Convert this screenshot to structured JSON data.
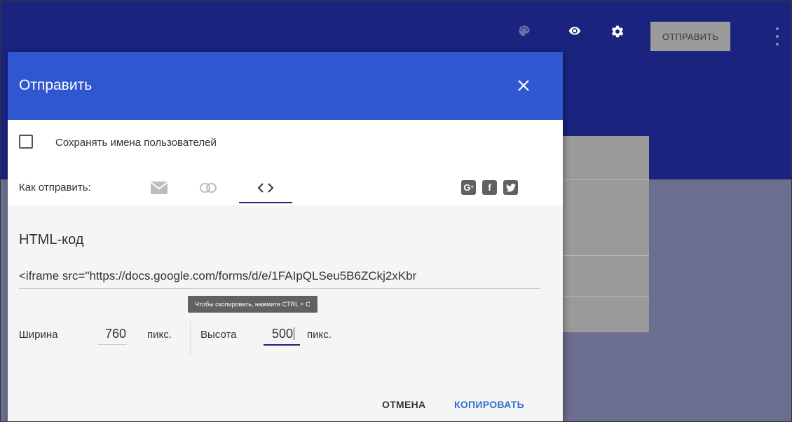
{
  "topbar": {
    "send_label": "ОТПРАВИТЬ",
    "icons": [
      "palette-icon",
      "eye-icon",
      "gear-icon",
      "more-vert-icon"
    ],
    "bg_color": "#1a237e"
  },
  "dialog": {
    "title": "Отправить",
    "header_color": "#2f57d0",
    "save_names_label": "Сохранять имена пользователей",
    "save_names_checked": false,
    "how_to_send_label": "Как отправить:",
    "methods": [
      "email-icon",
      "link-icon",
      "embed-code-icon"
    ],
    "active_method": "embed-code-icon",
    "social": [
      "G+",
      "f",
      "twitter"
    ],
    "html_section": {
      "title": "HTML-код",
      "code": "<iframe src=\"https://docs.google.com/forms/d/e/1FAIpQLSeu5B6ZCkj2xKbr",
      "tooltip": "Чтобы скопировать, нажмите CTRL + C",
      "width_label": "Ширина",
      "width_value": "760",
      "width_unit": "пикс.",
      "height_label": "Высота",
      "height_value": "500",
      "height_unit": "пикс."
    },
    "cancel_label": "ОТМЕНА",
    "copy_label": "КОПИРОВАТЬ"
  }
}
